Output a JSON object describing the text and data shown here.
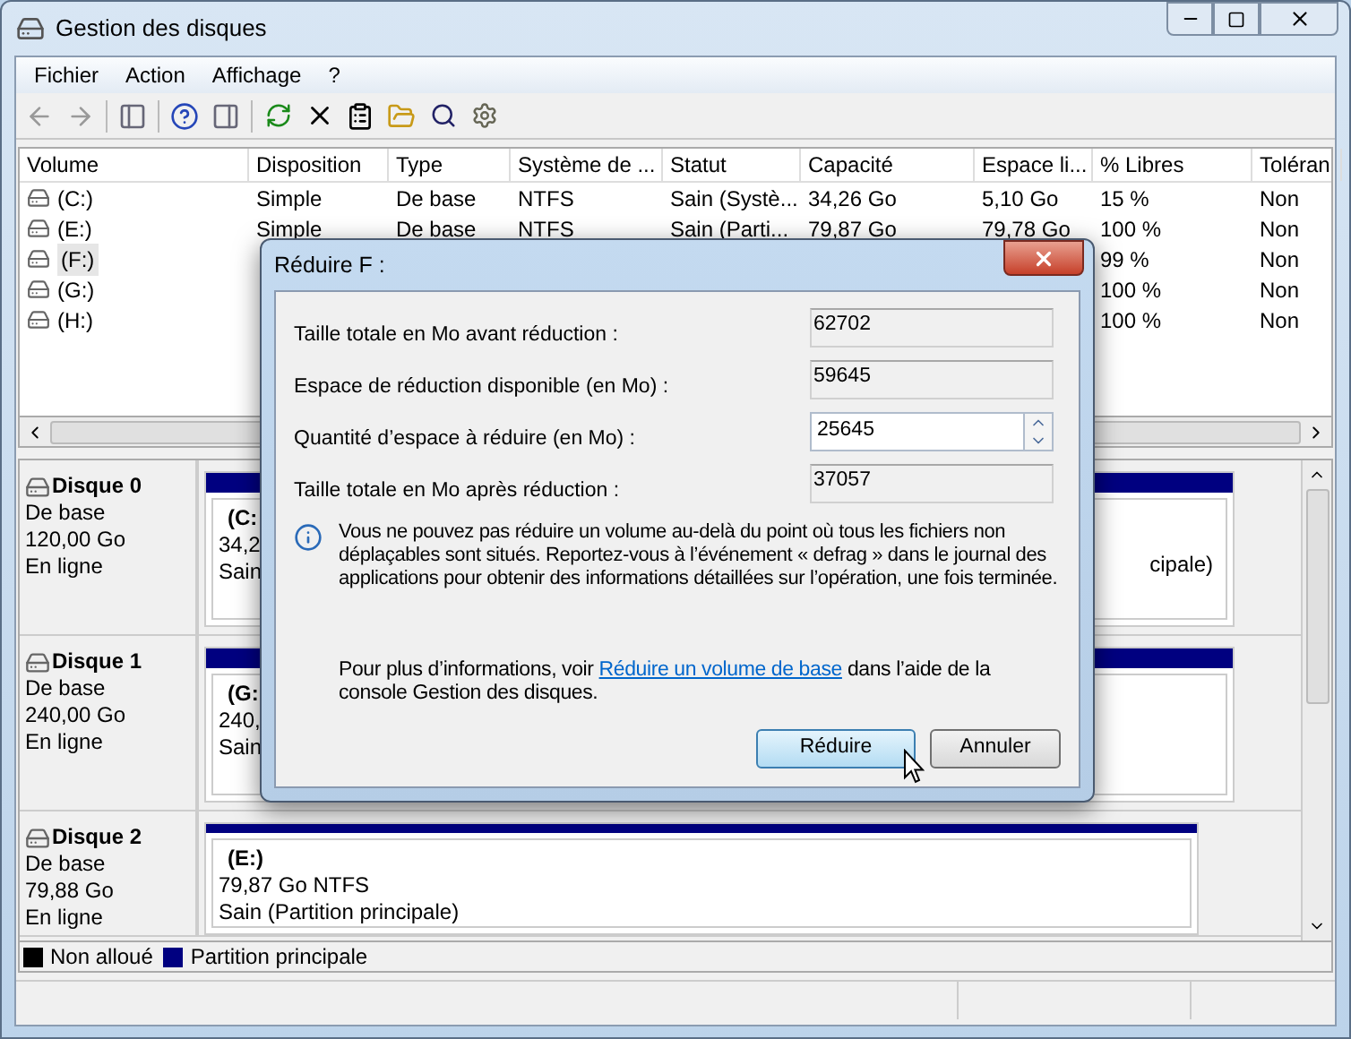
{
  "window": {
    "title": "Gestion des disques"
  },
  "menu": [
    "Fichier",
    "Action",
    "Affichage",
    "?"
  ],
  "volume_table": {
    "columns": [
      "Volume",
      "Disposition",
      "Type",
      "Système de ...",
      "Statut",
      "Capacité",
      "Espace li...",
      "% Libres",
      "Toléran"
    ],
    "rows": [
      {
        "selected": false,
        "volume": "(C:)",
        "layout": "Simple",
        "type": "De base",
        "file_system": "NTFS",
        "status": "Sain (Systè...",
        "capacity": "34,26 Go",
        "free_space": "5,10 Go",
        "percent_free": "15 %",
        "fault_tolerance": "Non"
      },
      {
        "selected": false,
        "volume": "(E:)",
        "layout": "Simple",
        "type": "De base",
        "file_system": "NTFS",
        "status": "Sain (Parti...",
        "capacity": "79,87 Go",
        "free_space": "79,78 Go",
        "percent_free": "100 %",
        "fault_tolerance": "Non"
      },
      {
        "selected": true,
        "volume": "(F:)",
        "percent_free": "99 %",
        "fault_tolerance": "Non"
      },
      {
        "selected": false,
        "volume": "(G:)",
        "percent_free": "100 %",
        "fault_tolerance": "Non"
      },
      {
        "selected": false,
        "volume": "(H:)",
        "percent_free": "100 %",
        "fault_tolerance": "Non"
      }
    ]
  },
  "disks": [
    {
      "name": "Disque 0",
      "type": "De base",
      "size": "120,00 Go",
      "status": "En ligne",
      "partitions": [
        {
          "label": "(C:",
          "size": "34,2",
          "status": "Sain"
        },
        {
          "status": "cipale)"
        }
      ]
    },
    {
      "name": "Disque 1",
      "type": "De base",
      "size": "240,00 Go",
      "status": "En ligne",
      "partitions": [
        {
          "label": "(G:",
          "size": "240,",
          "status": "Sain"
        }
      ]
    },
    {
      "name": "Disque 2",
      "type": "De base",
      "size": "79,88 Go",
      "status": "En ligne",
      "partitions": [
        {
          "label": "(E:)",
          "size": "79,87 Go NTFS",
          "status": "Sain (Partition principale)"
        }
      ]
    }
  ],
  "legend": [
    {
      "label": "Non alloué",
      "color": "#000000"
    },
    {
      "label": "Partition principale",
      "color": "#000080"
    }
  ],
  "dialog": {
    "title": "Réduire F :",
    "fields": [
      {
        "kind": "readonly",
        "label": "Taille totale en Mo avant réduction :",
        "value": "62702"
      },
      {
        "kind": "readonly",
        "label": "Espace de réduction disponible (en Mo) :",
        "value": "59645"
      },
      {
        "kind": "spin",
        "label": "Quantité d’espace à réduire (en Mo) :",
        "value": "25645"
      },
      {
        "kind": "readonly",
        "label": "Taille totale en Mo après réduction :",
        "value": "37057"
      }
    ],
    "info": "Vous ne pouvez pas réduire un volume au-delà du point où tous les fichiers non déplaçables sont situés. Reportez-vous à l’événement « defrag » dans le journal des applications pour obtenir des informations détaillées sur l’opération, une fois terminée.",
    "help": {
      "before": "Pour plus d’informations, voir ",
      "link": "Réduire un volume de base",
      "after": " dans l’aide de la console Gestion des disques."
    },
    "buttons": [
      {
        "label": "Réduire",
        "default": true
      },
      {
        "label": "Annuler",
        "default": false
      }
    ]
  }
}
